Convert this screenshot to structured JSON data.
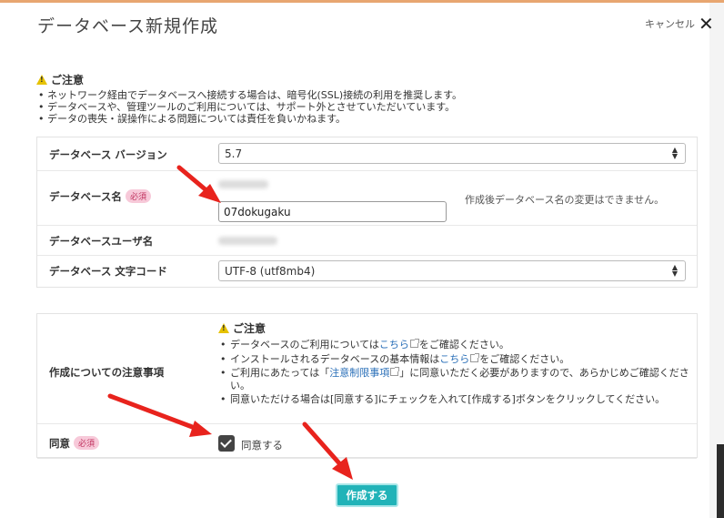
{
  "dialog": {
    "title": "データベース新規作成",
    "cancel_label": "キャンセル"
  },
  "notice": {
    "title": "ご注意",
    "items": [
      "ネットワーク経由でデータベースへ接続する場合は、暗号化(SSL)接続の利用を推奨します。",
      "データベースや、管理ツールのご利用については、サポート外とさせていただいています。",
      "データの喪失・誤操作による問題については責任を負いかねます。"
    ]
  },
  "form": {
    "version": {
      "label": "データベース バージョン",
      "value": "5.7"
    },
    "db_name": {
      "label": "データベース名",
      "required": "必須",
      "value": "07dokugaku",
      "hint": "作成後データベース名の変更はできません。"
    },
    "db_user": {
      "label": "データベースユーザ名"
    },
    "charset": {
      "label": "データベース 文字コード",
      "value": "UTF-8 (utf8mb4)"
    }
  },
  "caution": {
    "label": "作成についての注意事項",
    "title": "ご注意",
    "item1": {
      "pre": "データベースのご利用については",
      "link": "こちら",
      "post": "をご確認ください。"
    },
    "item2": {
      "pre": "インストールされるデータベースの基本情報は",
      "link": "こちら",
      "post": "をご確認ください。"
    },
    "item3": {
      "pre": "ご利用にあたっては「",
      "link": "注意制限事項",
      "post": "」に同意いただく必要がありますので、あらかじめご確認ください。"
    },
    "item4": "同意いただける場合は[同意する]にチェックを入れて[作成する]ボタンをクリックしてください。"
  },
  "agree": {
    "label": "同意",
    "required": "必須",
    "checkbox_label": "同意する",
    "checked": true
  },
  "submit_label": "作成する",
  "colors": {
    "accent": "#21b3b8",
    "arrow": "#e8231d",
    "required_bg": "#f7c9d9",
    "link": "#2a6fb8"
  }
}
